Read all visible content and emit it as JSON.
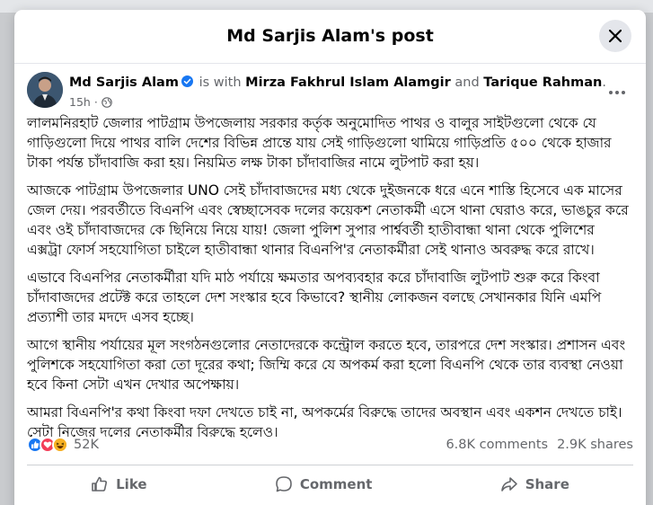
{
  "modal": {
    "title": "Md Sarjis Alam's post"
  },
  "post": {
    "author": "Md Sarjis Alam",
    "with_text": "is with",
    "tagged_1": "Mirza Fakhrul Islam Alamgir",
    "and_text": "and",
    "tagged_2": "Tarique Rahman",
    "period": ".",
    "time": "15h",
    "dot": "·",
    "paragraphs": [
      "লালমনিরহাট জেলার পাটগ্রাম উপজেলায় সরকার কর্তৃক অনুমোদিত পাথর ও বালুর সাইটগুলো থেকে যে গাড়িগুলো দিয়ে পাথর বালি দেশের বিভিন্ন প্রান্তে যায় সেই গাড়িগুলো থামিয়ে গাড়িপ্রতি ৫০০ থেকে হাজার টাকা পর্যন্ত চাঁদাবাজি করা হয়। নিয়মিত লক্ষ টাকা চাঁদাবাজির নামে লুটপাট করা হয়।",
      "আজকে পাটগ্রাম উপজেলার UNO সেই চাঁদাবাজদের মধ্য থেকে দুইজনকে ধরে এনে শাস্তি হিসেবে এক মাসের জেল দেয়। পরবর্তীতে বিএনপি এবং স্বেচ্ছাসেবক দলের কয়েকশ নেতাকর্মী এসে থানা ঘেরাও করে, ভাঙচুর করে এবং ওই চাঁদাবাজদের কে ছিনিয়ে নিয়ে যায়! জেলা পুলিশ সুপার পার্শ্ববর্তী হাতীবান্ধা থানা থেকে পুলিশের এক্সট্রা ফোর্স সহযোগিতা চাইলে হাতীবান্ধা থানার বিএনপি'র নেতাকর্মীরা সেই থানাও অবরুদ্ধ করে রাখে।",
      "এভাবে বিএনপির নেতাকর্মীরা যদি মাঠ পর্যায়ে ক্ষমতার অপব্যবহার করে চাঁদাবাজি লুটপাট শুরু করে কিংবা চাঁদাবাজদের প্রটেক্ট করে তাহলে দেশ সংস্কার হবে কিভাবে? স্থানীয় লোকজন বলছে সেখানকার যিনি এমপি প্রত্যাশী তার মদদে এসব হচ্ছে।",
      "আগে স্থানীয় পর্যায়ের মূল সংগঠনগুলোর নেতাদেরকে কন্ট্রোল করতে হবে, তারপরে দেশ সংস্কার। প্রশাসন এবং পুলিশকে সহযোগিতা করা তো দূরের কথা; জিম্মি করে যে অপকর্ম করা হলো বিএনপি থেকে তার ব্যবস্থা নেওয়া হবে কিনা সেটা এখন দেখার অপেক্ষায়।",
      "আমরা বিএনপি'র কথা কিংবা দফা দেখতে চাই না, অপকর্মের বিরুদ্ধে তাদের অবস্থান এবং একশন দেখতে চাই। সেটা নিজের দলের নেতাকর্মীর বিরুদ্ধে হলেও।"
    ]
  },
  "stats": {
    "reaction_count": "52K",
    "comments": "6.8K comments",
    "shares": "2.9K shares"
  },
  "actions": {
    "like": "Like",
    "comment": "Comment",
    "share": "Share"
  },
  "colors": {
    "accent": "#1877f2",
    "text_secondary": "#65676b"
  }
}
